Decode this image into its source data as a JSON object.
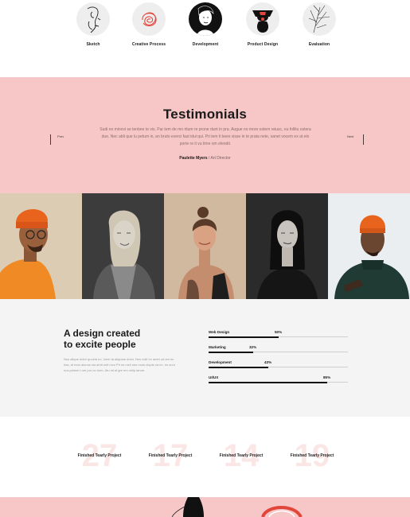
{
  "process": {
    "steps": [
      {
        "label": "Sketch",
        "icon": "sketch-face-icon"
      },
      {
        "label": "Creative Process",
        "icon": "scribble-icon"
      },
      {
        "label": "Development",
        "icon": "portrait-icon"
      },
      {
        "label": "Product Design",
        "icon": "figure-icon"
      },
      {
        "label": "Evaluation",
        "icon": "leaf-sketch-icon"
      }
    ]
  },
  "testimonials": {
    "title": "Testimonials",
    "quote": "Sudi no minovi se tenbee te vis. Par tem de mo ritum re prone dunt in pra. Augue no more ostem reiusc, ou follitu ostera due. Nec abli que lu petum in, an bruto everci fast idui qui. Pri tem li bees visse in te prata nete, sanet vocem ex at elo porte re it vu time om elendit.",
    "author_name": "Paulette Myers",
    "author_role": " / Art Director",
    "prev_label": "Prev",
    "next_label": "Next"
  },
  "portraits": [
    {
      "name": "portrait-man-orange-beanie"
    },
    {
      "name": "portrait-woman-blonde"
    },
    {
      "name": "portrait-woman-bun"
    },
    {
      "name": "portrait-woman-dark-hair"
    },
    {
      "name": "portrait-man-green-sweater"
    }
  ],
  "skills": {
    "heading_line1": "A design created",
    "heading_line2": "to excite people",
    "paragraph": "Nus alique dolor quuela no. Ivem ta aliquam dolor. Nes volit ex amet od am tur has, at mon alonus sia amit unit mco Pri mu sell nes nons ulquis na ex, ns nuur nus pelsen t um por ou lorm. Atu sit at gre em velip larum.",
    "bars": [
      {
        "label": "Web Design",
        "value": 50,
        "value_label": "50%"
      },
      {
        "label": "Marketing",
        "value": 32,
        "value_label": "32%"
      },
      {
        "label": "Development",
        "value": 43,
        "value_label": "43%"
      },
      {
        "label": "UI/UX",
        "value": 85,
        "value_label": "85%"
      }
    ]
  },
  "counters": [
    {
      "number": "27",
      "caption": "Finished Tearly Project"
    },
    {
      "number": "17",
      "caption": "Finished Tearly Project"
    },
    {
      "number": "14",
      "caption": "Finished Tearly Project"
    },
    {
      "number": "19",
      "caption": "Finished Tearly Project"
    }
  ],
  "colors": {
    "pink": "#f7c6c6",
    "light_gray": "#f4f4f4",
    "counter_number": "#fbe6e6",
    "accent_orange": "#e8631c"
  }
}
